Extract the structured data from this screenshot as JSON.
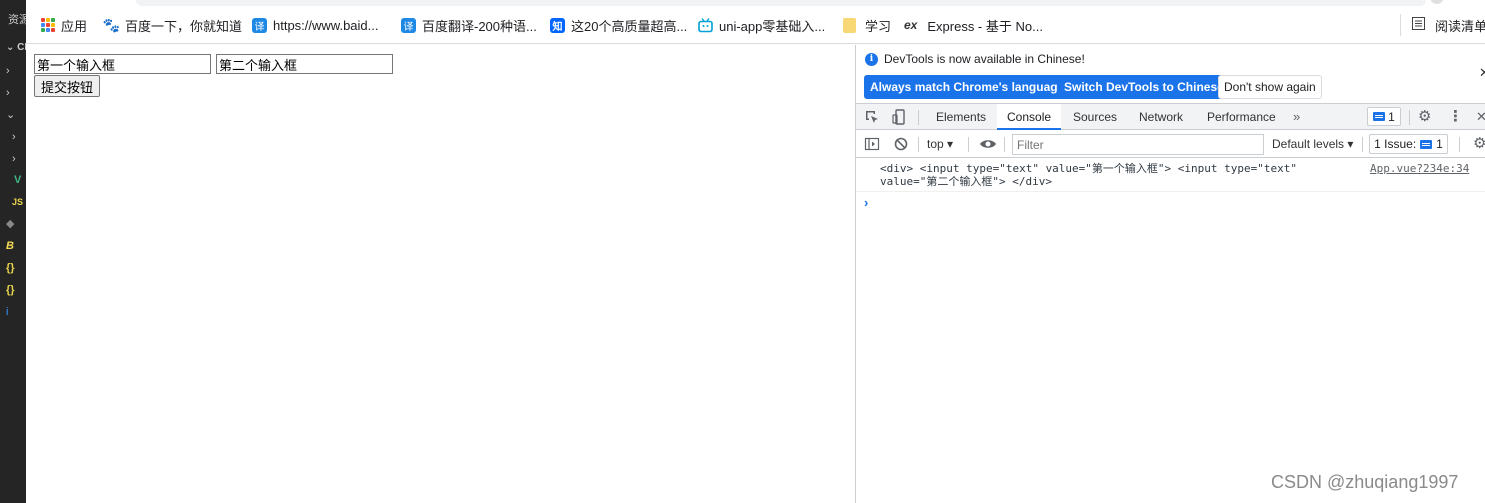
{
  "vscode": {
    "title": "资源",
    "folder": "CES",
    "file_icons": [
      "V",
      "JS",
      "B",
      "{}",
      "{}",
      "i"
    ]
  },
  "bookmarks": {
    "apps": "应用",
    "items": [
      {
        "label": "百度一下，你就知道",
        "icon": "baidu-paw-icon"
      },
      {
        "label": "https://www.baid...",
        "icon": "translate-icon"
      },
      {
        "label": "百度翻译-200种语...",
        "icon": "translate-icon"
      },
      {
        "label": "这20个高质量超高...",
        "icon": "zhihu-icon"
      },
      {
        "label": "uni-app零基础入...",
        "icon": "bilibili-icon"
      },
      {
        "label": "学习",
        "icon": "folder-icon"
      },
      {
        "label": "Express - 基于 No...",
        "icon": "express-icon"
      }
    ],
    "reading_list": "阅读清单",
    "translate_glyph": "译",
    "zhihu_glyph": "知",
    "express_glyph": "ex"
  },
  "page": {
    "input1_value": "第一个输入框",
    "input2_value": "第二个输入框",
    "submit_label": "提交按钮"
  },
  "devtools": {
    "info": {
      "text": "DevTools is now available in Chinese!",
      "btn_match": "Always match Chrome's language",
      "btn_switch": "Switch DevTools to Chinese",
      "btn_dont": "Don't show again"
    },
    "tabs": [
      "Elements",
      "Console",
      "Sources",
      "Network",
      "Performance"
    ],
    "active_tab": "Console",
    "issues_count": "1",
    "toolbar": {
      "context": "top",
      "filter_placeholder": "Filter",
      "levels": "Default levels",
      "issues_label": "1 Issue:",
      "issues_count": "1"
    },
    "console": {
      "log_line1": "<div> <input type=\"text\" value=\"第一个输入框\"> <input type=\"text\"",
      "log_line2": "value=\"第二个输入框\"> </div>",
      "source": "App.vue?234e:34"
    }
  },
  "watermark": "CSDN @zhuqiang1997",
  "colors": {
    "accent": "#1a73e8",
    "vscode_bg": "#252526"
  }
}
